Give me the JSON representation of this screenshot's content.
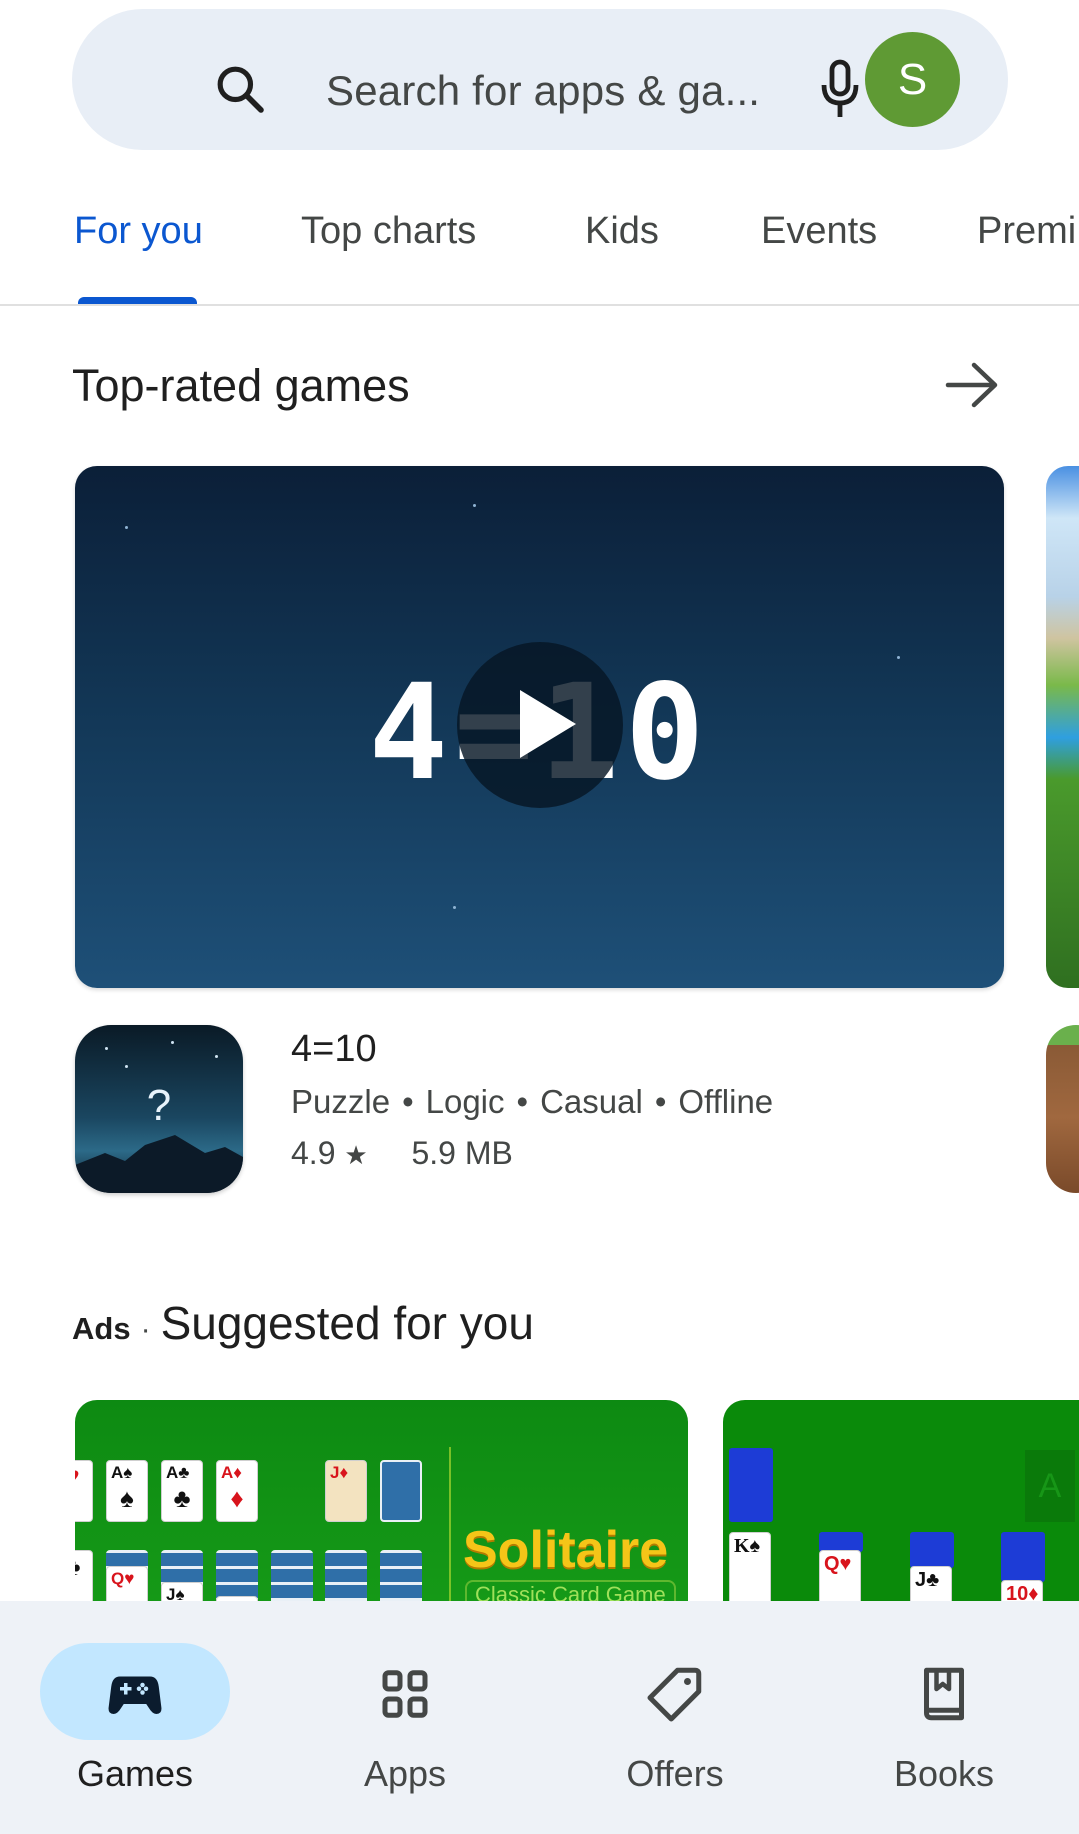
{
  "search": {
    "placeholder": "Search for apps & ga...",
    "avatar_initial": "S",
    "avatar_color": "#5f9a34"
  },
  "tabs": [
    {
      "label": "For you",
      "active": true
    },
    {
      "label": "Top charts",
      "active": false
    },
    {
      "label": "Kids",
      "active": false
    },
    {
      "label": "Events",
      "active": false
    },
    {
      "label": "Premi",
      "active": false
    }
  ],
  "accent_color": "#0b57d0",
  "top_rated": {
    "title": "Top-rated games",
    "featured": {
      "video_logo_text": "4=10",
      "app": {
        "name": "4=10",
        "tags": [
          "Puzzle",
          "Logic",
          "Casual",
          "Offline"
        ],
        "rating": "4.9",
        "rating_icon": "star-icon",
        "size": "5.9 MB",
        "icon_glyph": "?"
      }
    }
  },
  "ads_section": {
    "ads_label": "Ads",
    "separator": "·",
    "title": "Suggested for you",
    "cards": [
      {
        "brand_text": "Solitaire",
        "subtitle": "Classic Card Game"
      },
      {
        "ghost_card": "A"
      }
    ]
  },
  "bottom_nav": [
    {
      "label": "Games",
      "icon": "gamepad-icon",
      "active": true
    },
    {
      "label": "Apps",
      "icon": "apps-grid-icon",
      "active": false
    },
    {
      "label": "Offers",
      "icon": "tag-icon",
      "active": false
    },
    {
      "label": "Books",
      "icon": "book-icon",
      "active": false
    }
  ]
}
